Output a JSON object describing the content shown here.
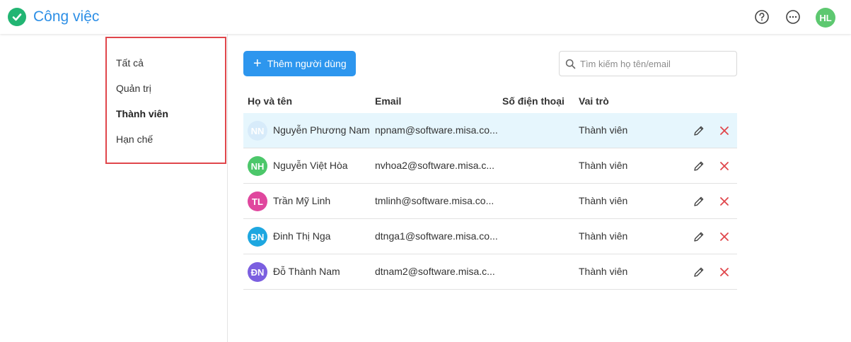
{
  "header": {
    "title": "Công việc",
    "user_initials": "HL",
    "help_icon": "question-circle-icon",
    "more_icon": "more-horizontal-icon"
  },
  "filters": {
    "items": [
      {
        "label": "Tất cả",
        "active": false
      },
      {
        "label": "Quản trị",
        "active": false
      },
      {
        "label": "Thành viên",
        "active": true
      },
      {
        "label": "Hạn chế",
        "active": false
      }
    ]
  },
  "toolbar": {
    "add_label": "Thêm người dùng",
    "search_placeholder": "Tìm kiếm họ tên/email"
  },
  "table": {
    "columns": [
      "Họ và tên",
      "Email",
      "Số điện thoại",
      "Vai trò"
    ],
    "rows": [
      {
        "initials": "NN",
        "name": "Nguyễn Phương Nam",
        "email": "npnam@software.misa.co...",
        "phone": "",
        "role": "Thành viên",
        "color": "#d7ebfa"
      },
      {
        "initials": "NH",
        "name": "Nguyễn Việt Hòa",
        "email": "nvhoa2@software.misa.c...",
        "phone": "",
        "role": "Thành viên",
        "color": "#4cc76a"
      },
      {
        "initials": "TL",
        "name": "Trần Mỹ Linh",
        "email": "tmlinh@software.misa.co...",
        "phone": "",
        "role": "Thành viên",
        "color": "#e0479e"
      },
      {
        "initials": "ĐN",
        "name": "Đinh Thị Nga",
        "email": "dtnga1@software.misa.co...",
        "phone": "",
        "role": "Thành viên",
        "color": "#1ea7e0"
      },
      {
        "initials": "ĐN",
        "name": "Đỗ Thành Nam",
        "email": "dtnam2@software.misa.c...",
        "phone": "",
        "role": "Thành viên",
        "color": "#7b5fe0"
      }
    ]
  },
  "colors": {
    "accent": "#2d96ee",
    "logo": "#22b573",
    "delete": "#e0464b",
    "row_highlight": "#e6f6fd"
  }
}
